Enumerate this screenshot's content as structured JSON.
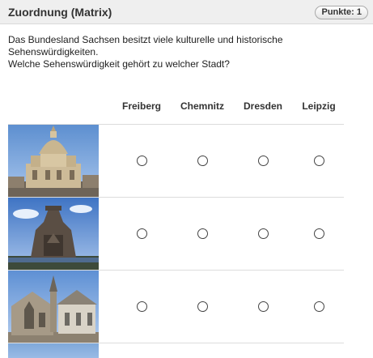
{
  "header": {
    "title": "Zuordnung (Matrix)",
    "points_badge": "Punkte: 1"
  },
  "question": {
    "line1": "Das Bundesland Sachsen besitzt viele kulturelle und historische Sehenswürdigkeiten.",
    "line2": "Welche Sehenswürdigkeit gehört zu welcher Stadt?"
  },
  "matrix": {
    "columns": [
      "Freiberg",
      "Chemnitz",
      "Dresden",
      "Leipzig"
    ],
    "rows": [
      {
        "image": "frauenkirche-photo",
        "selected": null
      },
      {
        "image": "monument-photo",
        "selected": null
      },
      {
        "image": "cathedral-photo",
        "selected": null
      }
    ]
  },
  "colors": {
    "header_bg": "#efefef",
    "divider": "#dcdcdc",
    "sky": "#7fa9d9"
  }
}
